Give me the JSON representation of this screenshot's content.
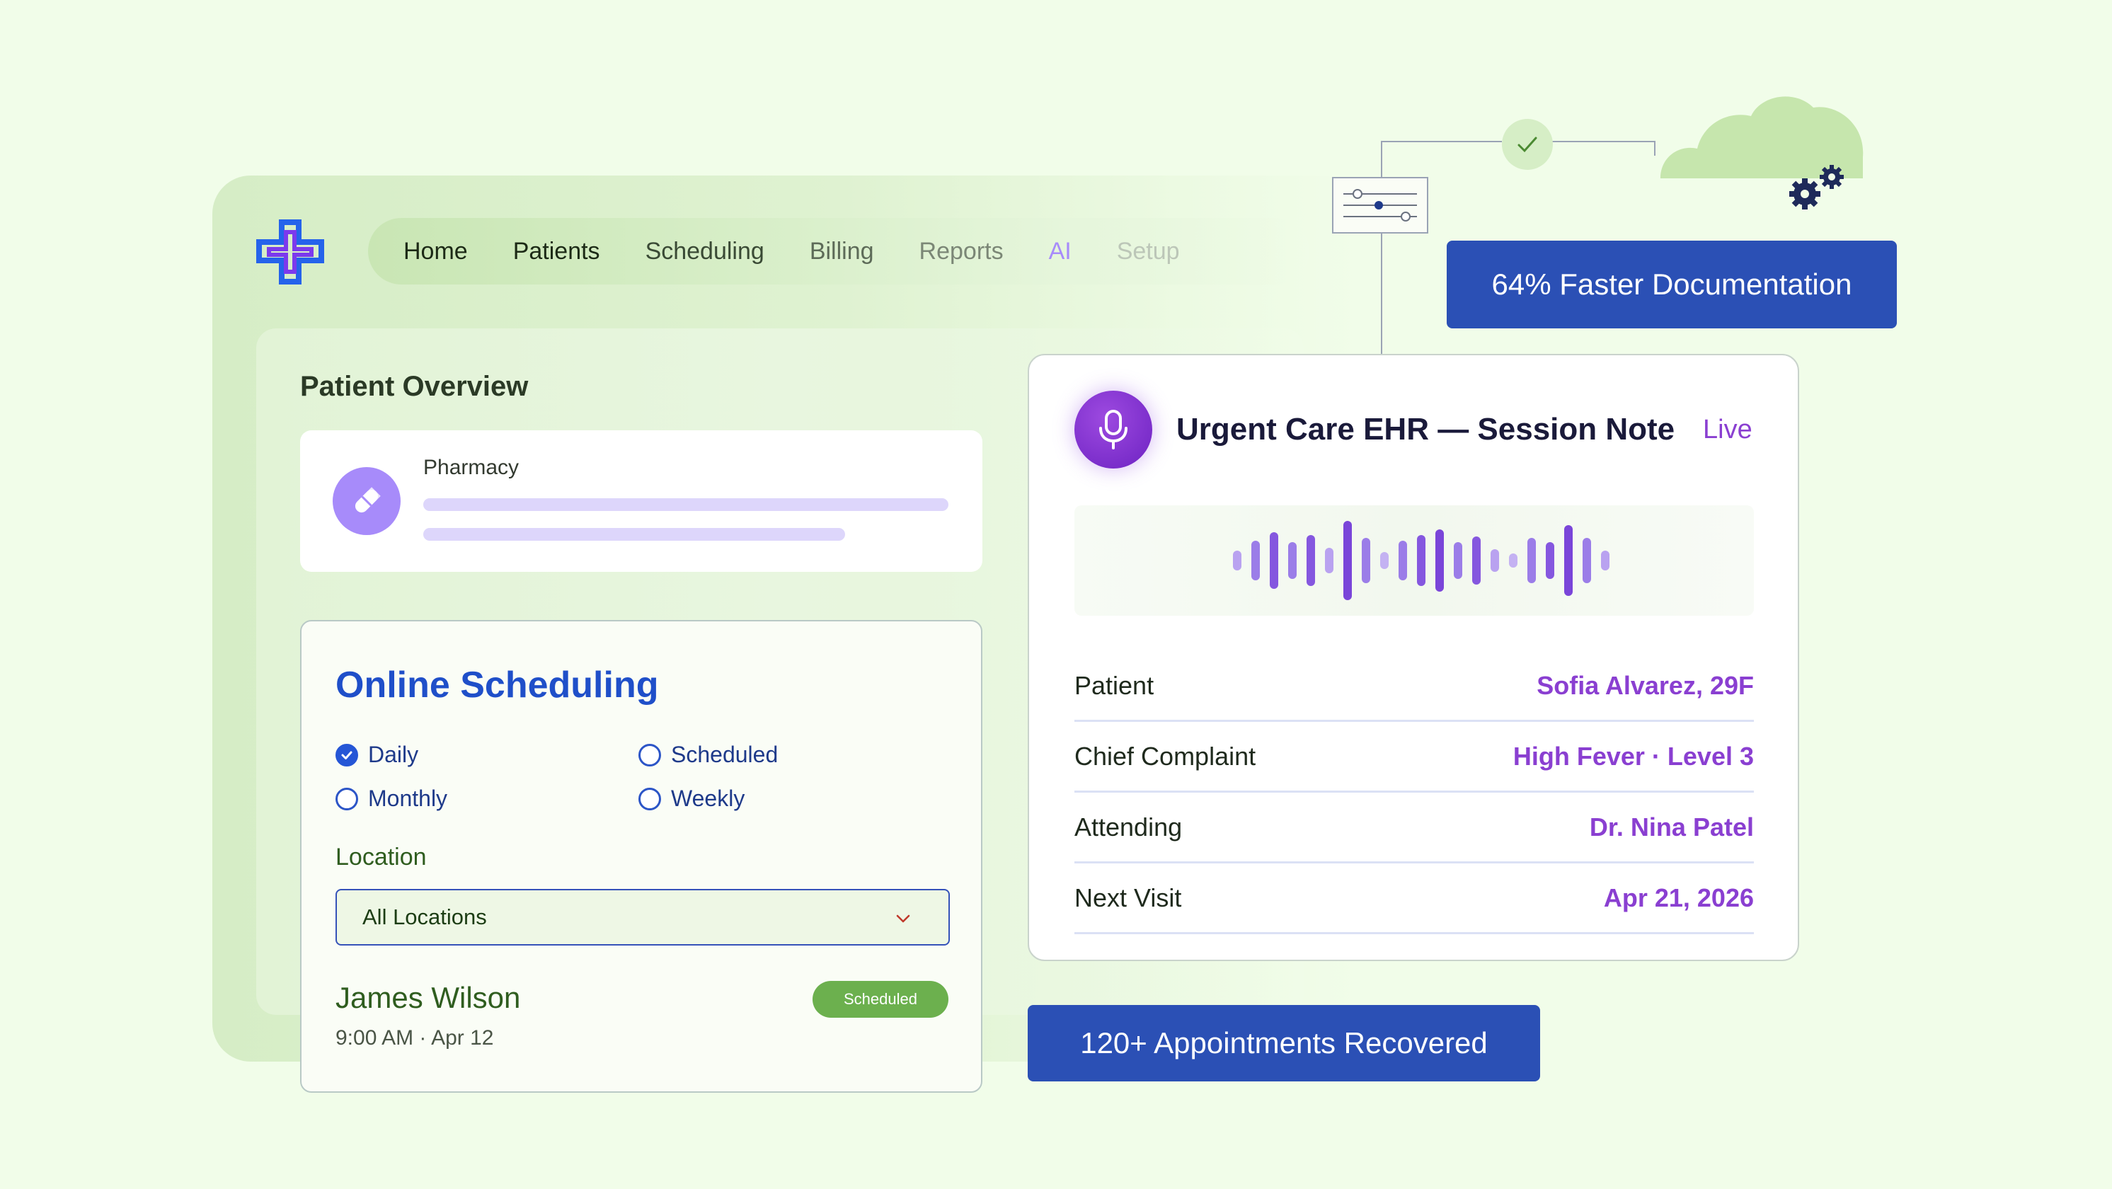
{
  "nav": {
    "items": [
      "Home",
      "Patients",
      "Scheduling",
      "Billing",
      "Reports",
      "AI",
      "Setup"
    ]
  },
  "overview": {
    "title": "Patient Overview",
    "pharmacy_label": "Pharmacy"
  },
  "scheduling": {
    "title": "Online Scheduling",
    "options": {
      "daily": "Daily",
      "scheduled": "Scheduled",
      "monthly": "Monthly",
      "weekly": "Weekly"
    },
    "selected_option": "Daily",
    "location_label": "Location",
    "location_value": "All Locations",
    "appointment": {
      "patient": "James Wilson",
      "time": "9:00 AM · Apr 12",
      "status": "Scheduled"
    }
  },
  "session_note": {
    "title": "Urgent Care EHR — Session Note",
    "live": "Live",
    "fields": [
      {
        "label": "Patient",
        "value": "Sofia Alvarez, 29F"
      },
      {
        "label": "Chief Complaint",
        "value": "High Fever · Level 3"
      },
      {
        "label": "Attending",
        "value": "Dr. Nina Patel"
      },
      {
        "label": "Next Visit",
        "value": "Apr 21, 2026"
      }
    ]
  },
  "badges": {
    "documentation": "64% Faster Documentation",
    "appointments": "120+ Appointments Recovered"
  },
  "icons": [
    "medical-cross-logo-icon",
    "pill-icon",
    "microphone-icon",
    "chevron-down-icon",
    "checkmark-icon",
    "sliders-icon",
    "cloud-icon",
    "gears-icon",
    "waveform-icon"
  ],
  "colors": {
    "accent_blue": "#2b50b5",
    "accent_purple": "#8a3fd1",
    "status_green": "#6cb04e",
    "background": "#f1fde9"
  }
}
